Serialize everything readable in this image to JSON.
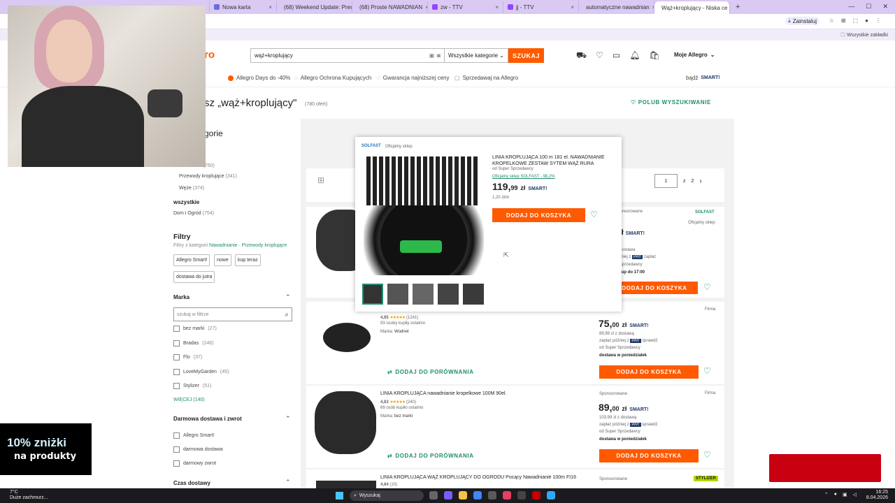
{
  "browser": {
    "tabs": [
      {
        "label": "Nowa karta",
        "color": "#6b6bd9"
      },
      {
        "label": "(68) Weekend Update: Pres",
        "color": "#ff0000"
      },
      {
        "label": "(68) Proste NAWADNIAN",
        "color": "#ff0000"
      },
      {
        "label": "zw - TTV",
        "color": "#9146ff"
      },
      {
        "label": "jj - TTV",
        "color": "#9146ff"
      },
      {
        "label": "automatyczne nawadnian",
        "color": "#4285f4"
      },
      {
        "label": "Wąż+kroplujący - Niska ce",
        "color": "#ff5a00"
      }
    ],
    "install_label": "Zainstaluj",
    "all_bookmarks": "Wszystkie zakładki"
  },
  "header": {
    "logo_text": "ro",
    "search_query": "wąż+kroplujący",
    "category": "Wszystkie kategorie",
    "search_button": "SZUKAJ",
    "my_allegro": "Moje Allegro"
  },
  "promo_bar": {
    "items": [
      "Allegro Days do -40%",
      "Allegro Ochrona Kupujących",
      "Gwarancja najniższej ceny",
      "Sprzedawaj na Allegro"
    ],
    "smart_prefix": "bądź",
    "smart_label": "SMART!"
  },
  "results": {
    "title": "sz „wąż+kroplujący\"",
    "count": "(780 ofert)",
    "save_search": "POLUB WYSZUKIWANIE"
  },
  "sidebar": {
    "categories_heading": "gorie",
    "cat_items": [
      {
        "label": "Nawadnianie",
        "count": "(750)"
      },
      {
        "label": "Przewody kroplujące",
        "count": "(341)"
      },
      {
        "label": "Węże",
        "count": "(374)"
      }
    ],
    "all_heading": "wszystkie",
    "all_item": {
      "label": "Dom i Ogród",
      "count": "(754)"
    },
    "filters_heading": "Filtry",
    "filters_from": "Filtry z kategorii",
    "filters_link": "Nawadnianie · Przewody kroplujące",
    "tags": [
      "Allegro Smart!",
      "nowe",
      "kup teraz",
      "dostawa do jutra"
    ],
    "brand_heading": "Marka",
    "brand_search_placeholder": "szukaj w filtrze",
    "brands": [
      {
        "label": "bez marki",
        "count": "(27)"
      },
      {
        "label": "Bradas",
        "count": "(146)"
      },
      {
        "label": "Flo",
        "count": "(37)"
      },
      {
        "label": "LoveMyGarden",
        "count": "(45)"
      },
      {
        "label": "Stylizer",
        "count": "(51)"
      }
    ],
    "more": "WIĘCEJ (140)",
    "delivery_heading": "Darmowa dostawa i zwrot",
    "delivery_opts": [
      "Allegro Smart!",
      "darmowa dostawa",
      "darmowy zwrot"
    ],
    "time_heading": "Czas dostawy"
  },
  "pager": {
    "current": "1",
    "of": "z",
    "total": "2"
  },
  "popover": {
    "seller_badge": "SOLFAST",
    "official": "Oficjalny sklep",
    "title": "LINIA KROPLUJĄCA 100 m 181 el. NAWADNIANIE KROPELKOWE ZESTAW SYTEM WĄŻ RURA",
    "super_seller": "od Super Sprzedawcy",
    "shop_link": "Oficjalny sklep SOLFAST - 98,2%",
    "price_int": "119,",
    "price_dec": "99",
    "currency": "zł",
    "smart": "SMART!",
    "unit_price": "1,20 zł/m",
    "add_to_cart": "DODAJ DO KOSZYKA"
  },
  "offers": [
    {
      "sponsored": "Sponsorowane",
      "shop_badge": "SOLFAST",
      "official": "Oficjalny sklep",
      "price_frag": "9 zł",
      "smart": "SMART!",
      "lines": [
        "dostawa",
        "ć później z",
        "PAY",
        "zapłać",
        "Sprzedawcy",
        "ro · kup do 17:00"
      ],
      "add_to_cart": "DODAJ DO KOSZYKA"
    },
    {
      "rating": "4,85",
      "stars": "★★★★★",
      "reviews": "(1241)",
      "bought": "93 osoby kupiły ostatnio",
      "brand_label": "Marka:",
      "brand": "Wodnet",
      "compare": "DODAJ DO PORÓWNANIA",
      "firm": "Firma",
      "price_int": "75,",
      "price_dec": "00",
      "currency": "zł",
      "smart": "SMART!",
      "with_delivery": "89,99 zł z dostawą",
      "pay_later": "zapłać później z",
      "pay": "PAY",
      "pay_suffix": "sprawdź",
      "super_seller": "od Super Sprzedawcy",
      "delivery": "dostawa w poniedziałek",
      "add_to_cart": "DODAJ DO KOSZYKA"
    },
    {
      "title": "LINIA KROPLUJĄCA nawadnianie kropelkowe 100M 90el.",
      "rating": "4,83",
      "stars": "★★★★★",
      "reviews": "(240)",
      "bought": "69 osób kupiło ostatnio",
      "brand_label": "Marka:",
      "brand": "bez marki",
      "compare": "DODAJ DO PORÓWNANIA",
      "sponsored": "Sponsorowane",
      "firm": "Firma",
      "price_int": "89,",
      "price_dec": "00",
      "currency": "zł",
      "smart": "SMART!",
      "with_delivery": "103,99 zł z dostawą",
      "pay_later": "zapłać później z",
      "pay": "PAY",
      "pay_suffix": "sprawdź",
      "super_seller": "od Super Sprzedawcy",
      "delivery": "dostawa w poniedziałek",
      "add_to_cart": "DODAJ DO KOSZYKA"
    },
    {
      "title": "LINIA KROPLUJĄCA WĄŻ KROPLUJĄCY DO OGRODU Pocący Nawadnianie 100m FI16",
      "rating": "4,84",
      "reviews": "(10)",
      "sponsored": "Sponsorowane",
      "shop_badge": "STYLIZER"
    }
  ],
  "overlay": {
    "promo_line1": "10% zniżki",
    "promo_line2": "na produkty"
  },
  "taskbar": {
    "temp": "7°C",
    "weather": "Duże zachmurz...",
    "search": "Wyszukaj",
    "time": "16:25",
    "date": "8.04.2026"
  },
  "colors": {
    "allegro_orange": "#ff5a00",
    "allegro_green": "#1f8d6f",
    "tab_strip": "#d9c9f3"
  }
}
